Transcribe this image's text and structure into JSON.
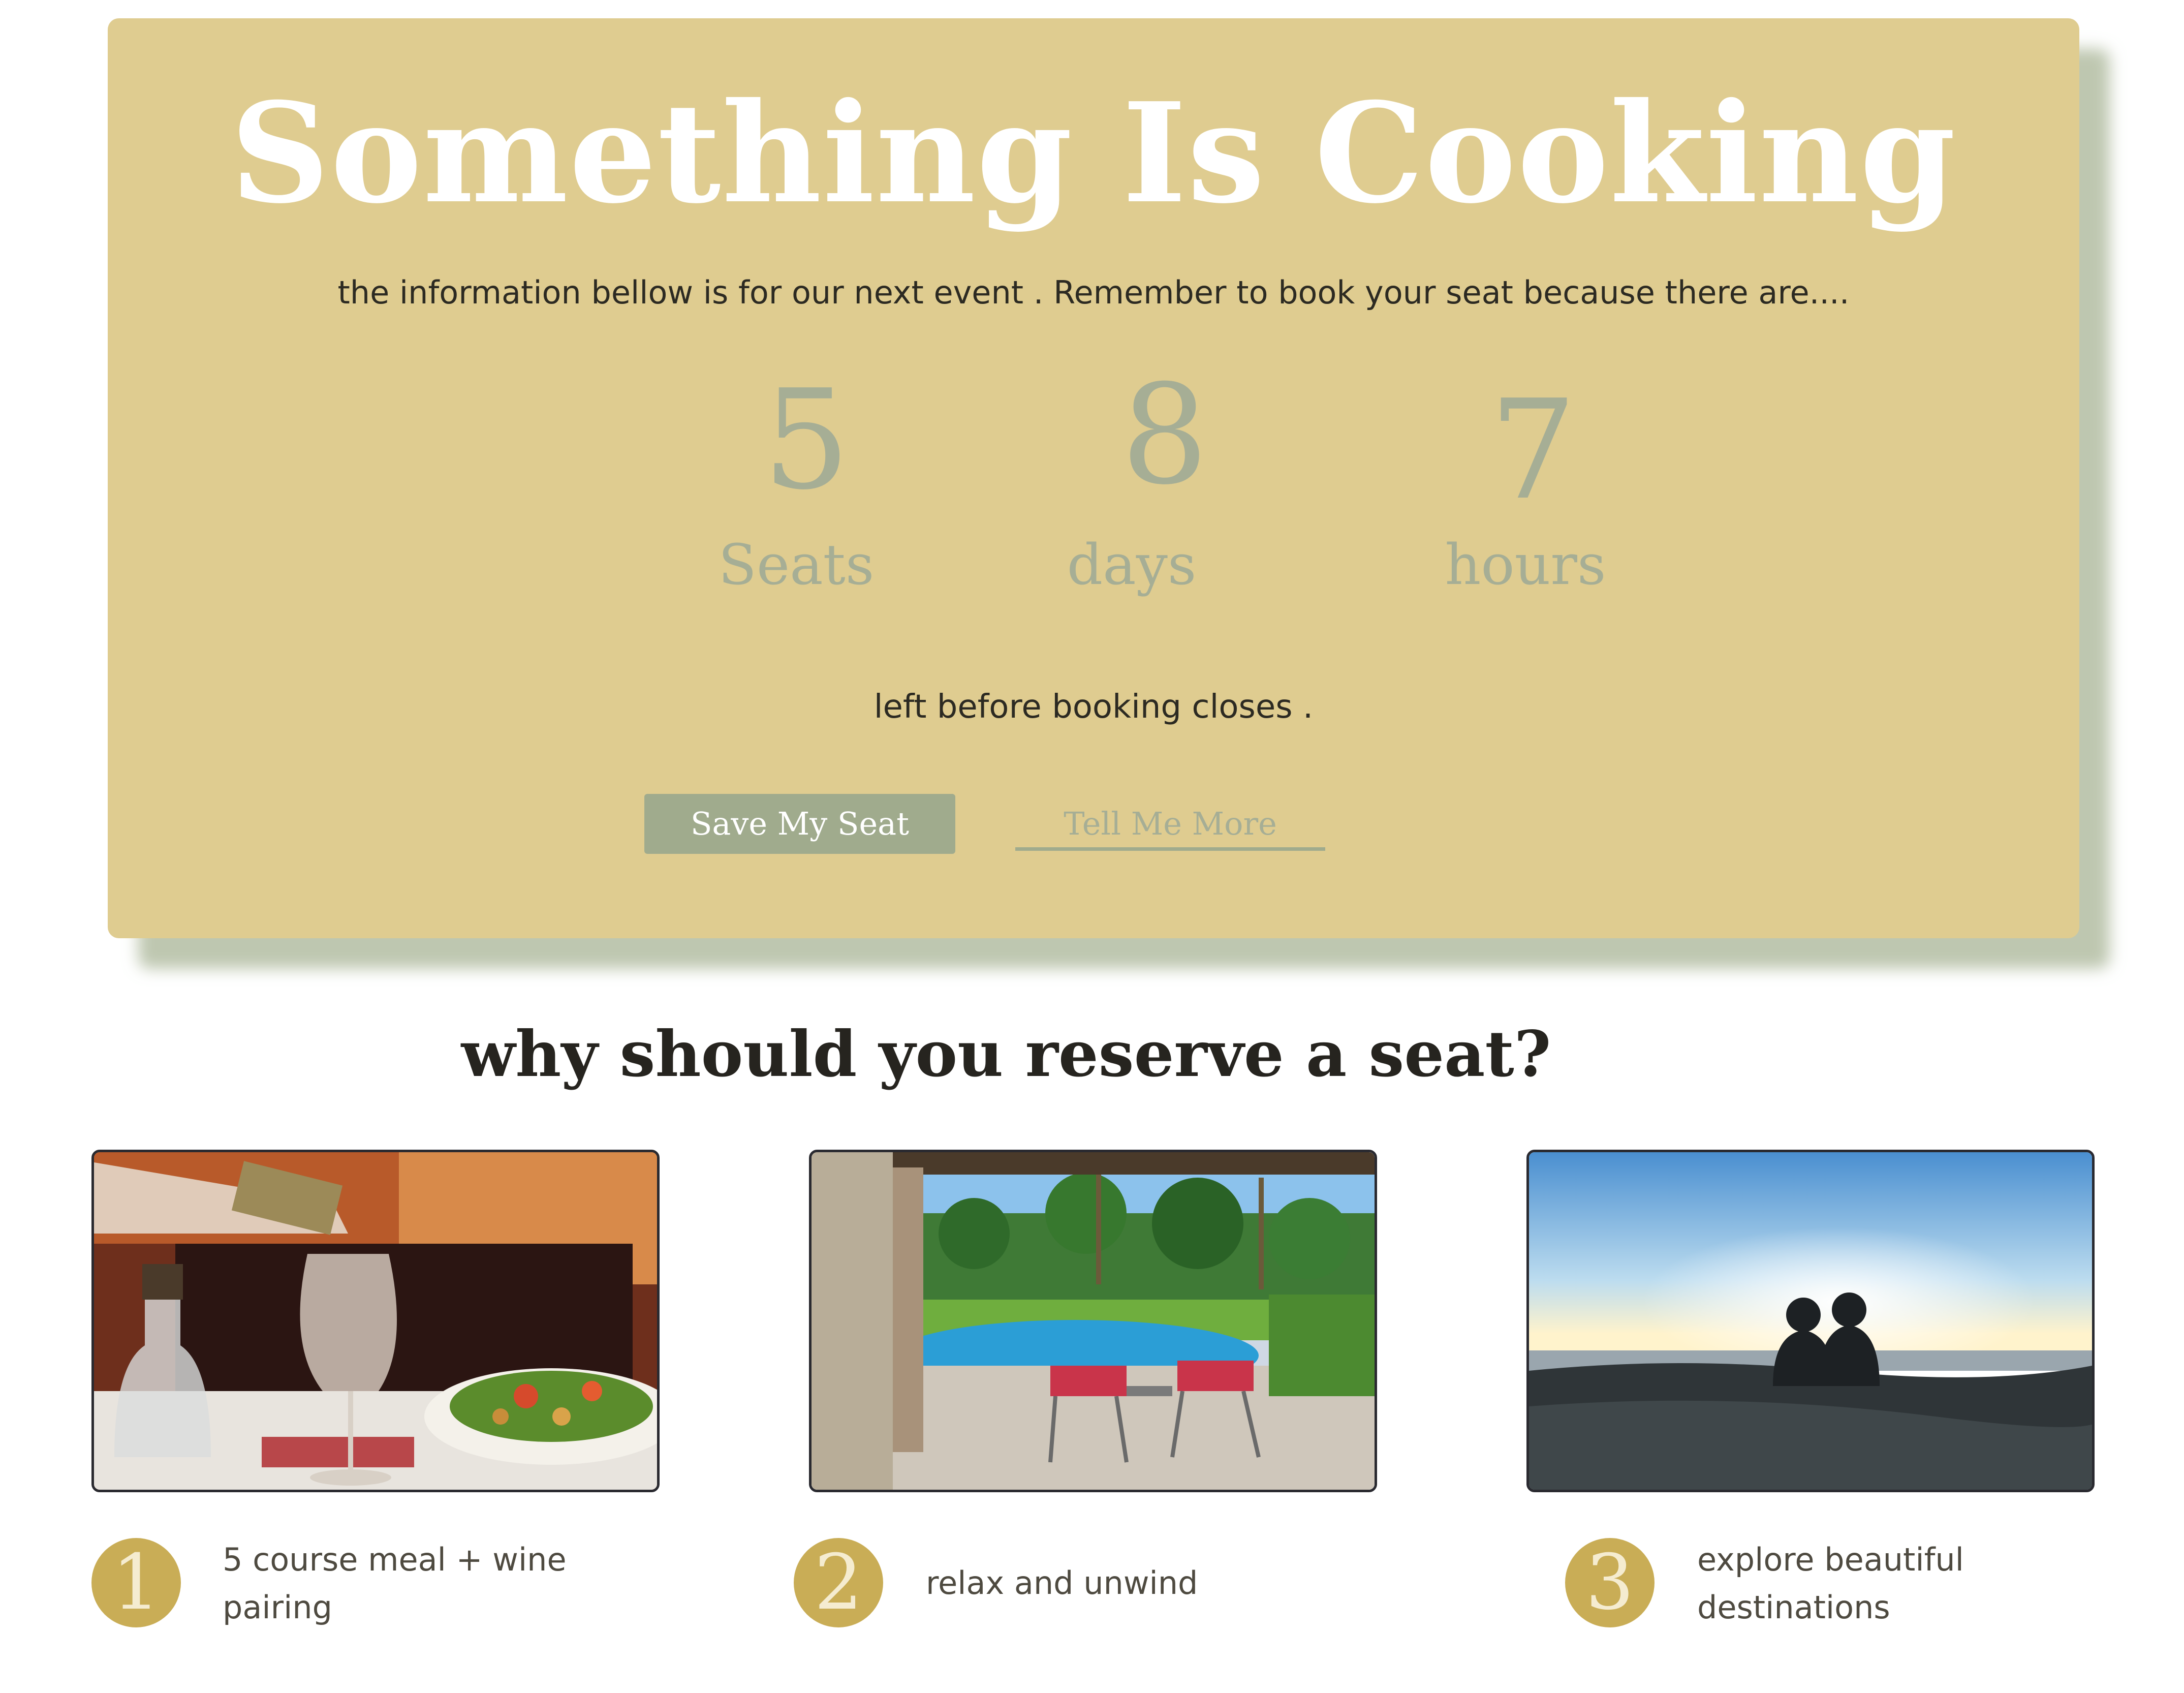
{
  "hero": {
    "title": "Something Is Cooking",
    "subtitle": "the information bellow is  for our next event . Remember to book your seat because there are....",
    "counters": [
      {
        "value": "5",
        "label": "Seats"
      },
      {
        "value": "8",
        "label": "days"
      },
      {
        "value": "7",
        "label": "hours"
      }
    ],
    "closing": "left before booking closes .",
    "primary_button": "Save My Seat",
    "secondary_button": "Tell Me More"
  },
  "features": {
    "heading": "why should you reserve a seat?",
    "items": [
      {
        "number": "1",
        "text": "5 course meal + wine pairing",
        "photo_icon": "wine-dinner-photo"
      },
      {
        "number": "2",
        "text": "relax and unwind",
        "photo_icon": "pool-patio-photo"
      },
      {
        "number": "3",
        "text": "explore beautiful destinations",
        "photo_icon": "sunset-couple-photo"
      }
    ]
  },
  "colors": {
    "hero_background": "#dfcc90",
    "accent_sage": "#a0ab8d",
    "badge_gold": "#c9ad56"
  }
}
